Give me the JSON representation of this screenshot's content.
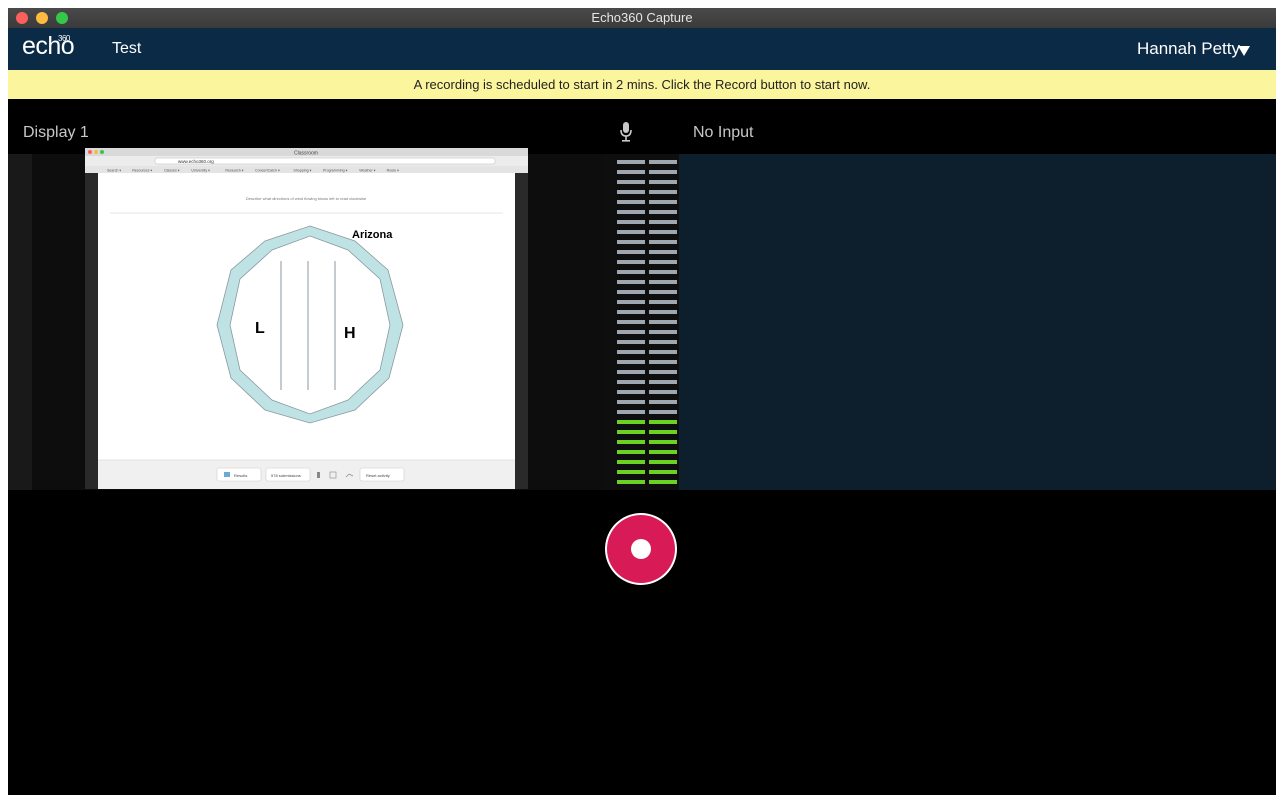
{
  "window": {
    "title": "Echo360 Capture"
  },
  "appbar": {
    "logo_text": "echo",
    "logo_sup": "360",
    "context_title": "Test",
    "user_name": "Hannah Petty",
    "user_menu_icon": "caret-down-icon"
  },
  "banner": {
    "message": "A recording is scheduled to start in 2 mins. Click the Record button to start now."
  },
  "display": {
    "label": "Display 1"
  },
  "audio": {
    "label": "No Input",
    "icon": "microphone-icon",
    "meter_level": 0.2
  },
  "preview": {
    "app_title": "Classroom",
    "url": "www.echo360.org",
    "nav_menus": [
      "Search",
      "Resources",
      "Classes",
      "University",
      "Research",
      "ConcertCatch",
      "Shopping",
      "Programming",
      "Weather",
      "Route"
    ],
    "instruction": "Describe what directions of wind flowing blows left to read clockwise",
    "region_label": "Arizona",
    "low_label": "L",
    "high_label": "H",
    "toolbar": {
      "results": "Results",
      "submissions": "578 submissions",
      "reset": "Reset activity"
    }
  },
  "record_button": {
    "icon": "record-icon"
  },
  "colors": {
    "appbar": "#0b2a45",
    "banner": "#fbf59d",
    "record": "#d81b57",
    "meter_active": "#6bd224",
    "meter_idle": "#9ea7b0",
    "polygon": "#bfe2e4"
  }
}
